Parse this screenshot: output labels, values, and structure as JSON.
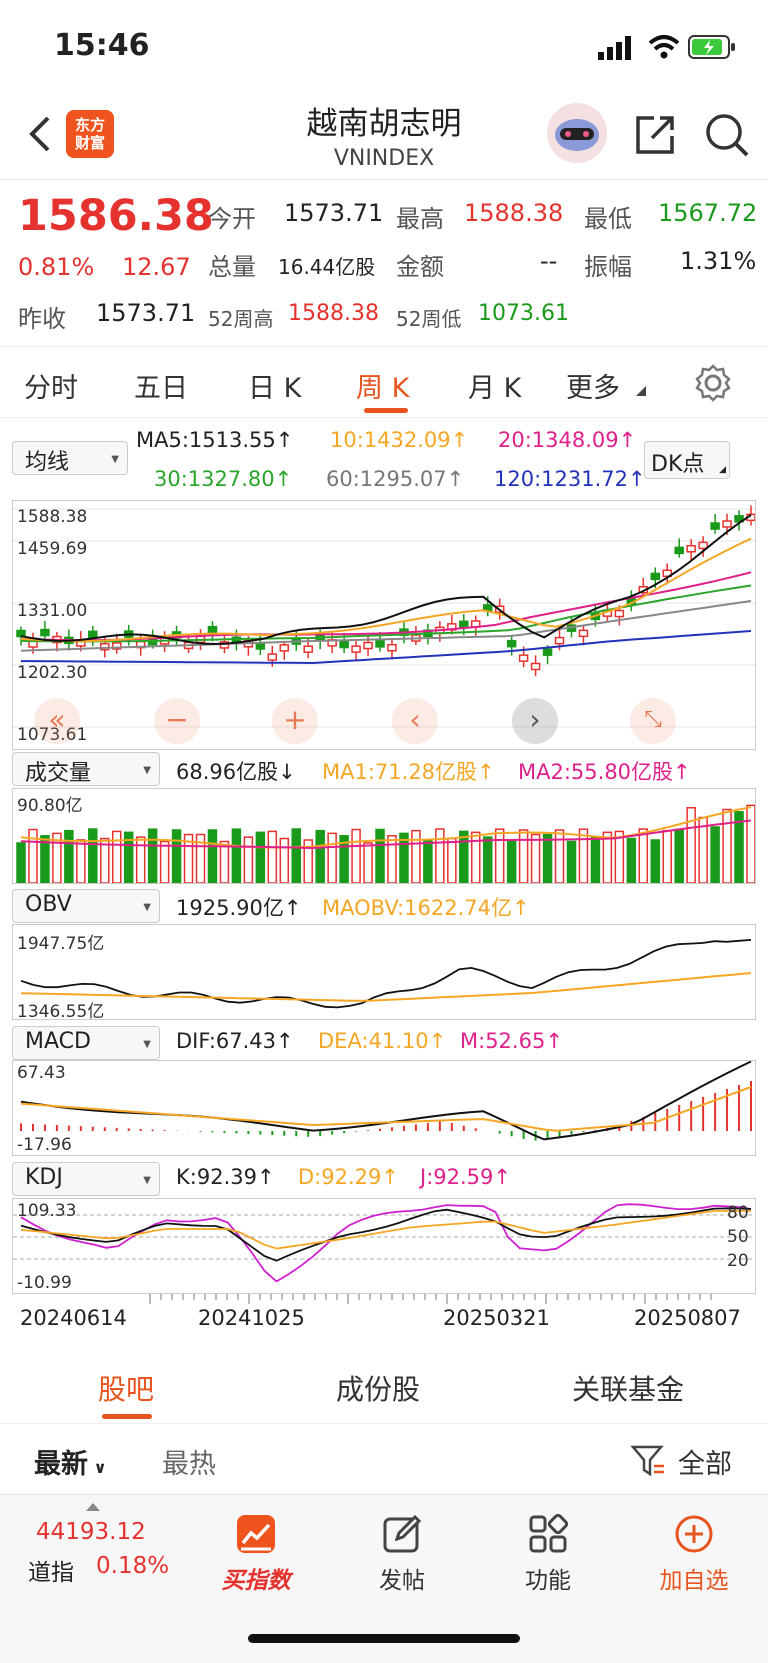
{
  "status": {
    "time": "15:46"
  },
  "header": {
    "title": "越南胡志明",
    "subtitle": "VNINDEX",
    "logo_line1": "东方",
    "logo_line2": "财富"
  },
  "quote": {
    "price": "1586.38",
    "change_pct": "0.81%",
    "change": "12.67",
    "prev_close_label": "昨收",
    "prev_close": "1573.71",
    "open_label": "今开",
    "open": "1573.71",
    "high_label": "最高",
    "high": "1588.38",
    "low_label": "最低",
    "low": "1567.72",
    "volume_label": "总量",
    "volume": "16.44亿股",
    "amount_label": "金额",
    "amount": "--",
    "amplitude_label": "振幅",
    "amplitude": "1.31%",
    "w52_high_label": "52周高",
    "w52_high": "1588.38",
    "w52_low_label": "52周低",
    "w52_low": "1073.61"
  },
  "tabs": [
    "分时",
    "五日",
    "日 K",
    "周 K",
    "月 K",
    "更多"
  ],
  "main_chart": {
    "selector": "均线",
    "dk_button": "DK点",
    "ma5": "MA5:1513.55↑",
    "ma10": "10:1432.09↑",
    "ma20": "20:1348.09↑",
    "ma30": "30:1327.80↑",
    "ma60": "60:1295.07↑",
    "ma120": "120:1231.72↑",
    "y_labels": [
      "1588.38",
      "1459.69",
      "1331.00",
      "1202.30",
      "1073.61"
    ]
  },
  "volume_panel": {
    "selector": "成交量",
    "value": "68.96亿股↓",
    "ma1": "MA1:71.28亿股↑",
    "ma2": "MA2:55.80亿股↑",
    "y_top": "90.80亿"
  },
  "obv_panel": {
    "selector": "OBV",
    "value": "1925.90亿↑",
    "maobv": "MAOBV:1622.74亿↑",
    "y_top": "1947.75亿",
    "y_bottom": "1346.55亿"
  },
  "macd_panel": {
    "selector": "MACD",
    "dif": "DIF:67.43↑",
    "dea": "DEA:41.10↑",
    "m": "M:52.65↑",
    "y_top": "67.43",
    "y_bottom": "-17.96"
  },
  "kdj_panel": {
    "selector": "KDJ",
    "k": "K:92.39↑",
    "d": "D:92.29↑",
    "j": "J:92.59↑",
    "y_top": "109.33",
    "y_bottom": "-10.99",
    "levels": [
      "80",
      "50",
      "20"
    ]
  },
  "x_labels": [
    "20240614",
    "20241025",
    "20250321",
    "20250807"
  ],
  "bottom_tabs": [
    "股吧",
    "成份股",
    "关联基金"
  ],
  "sub_tabs": {
    "latest": "最新",
    "hot": "最热",
    "filter": "全部"
  },
  "footer": {
    "index_value": "44193.12",
    "index_name": "道指",
    "index_pct": "0.18%",
    "items": [
      "买指数",
      "发帖",
      "功能",
      "加自选"
    ]
  },
  "colors": {
    "red": "#e6322e",
    "green": "#1a9a1a",
    "accent": "#e8541e",
    "ma10": "#f5a623",
    "ma20": "#e0208a",
    "ma30": "#2aa52a",
    "ma60": "#888888",
    "ma120": "#2233bb"
  }
}
